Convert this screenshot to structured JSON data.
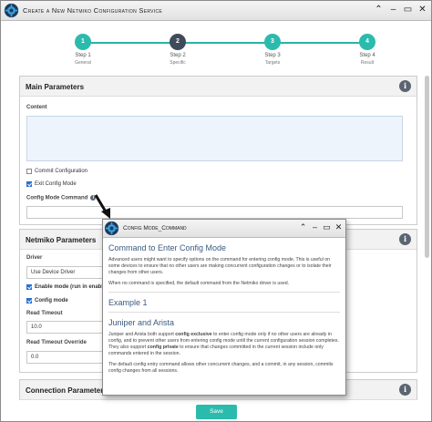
{
  "window": {
    "title": "Create a New Netmiko Configuration Service",
    "controls": [
      "chevron-up",
      "minimize",
      "maximize",
      "close"
    ]
  },
  "stepper": {
    "steps": [
      {
        "number": "1",
        "label": "Step 1",
        "sub": "General",
        "state": "done"
      },
      {
        "number": "2",
        "label": "Step 2",
        "sub": "Specific",
        "state": "current"
      },
      {
        "number": "3",
        "label": "Step 3",
        "sub": "Targets",
        "state": "done"
      },
      {
        "number": "4",
        "label": "Step 4",
        "sub": "Result",
        "state": "done"
      }
    ]
  },
  "main_panel": {
    "title": "Main Parameters",
    "content_label": "Content",
    "commit_config_label": "Commit Configuration",
    "exit_config_label": "Exit Config Mode",
    "config_mode_command_label": "Config Mode Command"
  },
  "netmiko_panel": {
    "title": "Netmiko Parameters",
    "driver_label": "Driver",
    "driver_value": "Use Device Driver",
    "enable_mode_label": "Enable mode (run in enable",
    "config_mode_label": "Config mode",
    "read_timeout_label": "Read Timeout",
    "read_timeout_value": "10.0",
    "read_timeout_override_label": "Read Timeout Override",
    "read_timeout_override_value": "0.0"
  },
  "connection_panel": {
    "title": "Connection Parameters"
  },
  "save_button": "Save",
  "popup": {
    "title": "Config Mode_Command",
    "heading": "Command to Enter Config Mode",
    "para1": "Advanced users might want to specify options on the command for entering config mode. This is useful on some devices to ensure that no other users are making concurrent configuration changes or to isolate their changes from other users.",
    "para2": "When no command is specified, the default command from the Netmiko driver is used.",
    "example_heading": "Example 1",
    "vendor_heading": "Juniper and Arista",
    "para3_a": "Juniper and Arista both support ",
    "para3_b": "config exclusive",
    "para3_c": " to enter config mode only if no other users are already in config, and to prevent other users from entering config mode until the current configuration session completes. They also support ",
    "para3_d": "config private",
    "para3_e": " to ensure that changes committed in the current session include only commands entered in the session.",
    "para4": "The default config entry command allows other concurrent changes, and a commit, in any session, commits config changes from all sessions."
  },
  "colors": {
    "accent": "#2bbbad",
    "current_step": "#3f4a5a",
    "heading_blue": "#3a5a80"
  }
}
